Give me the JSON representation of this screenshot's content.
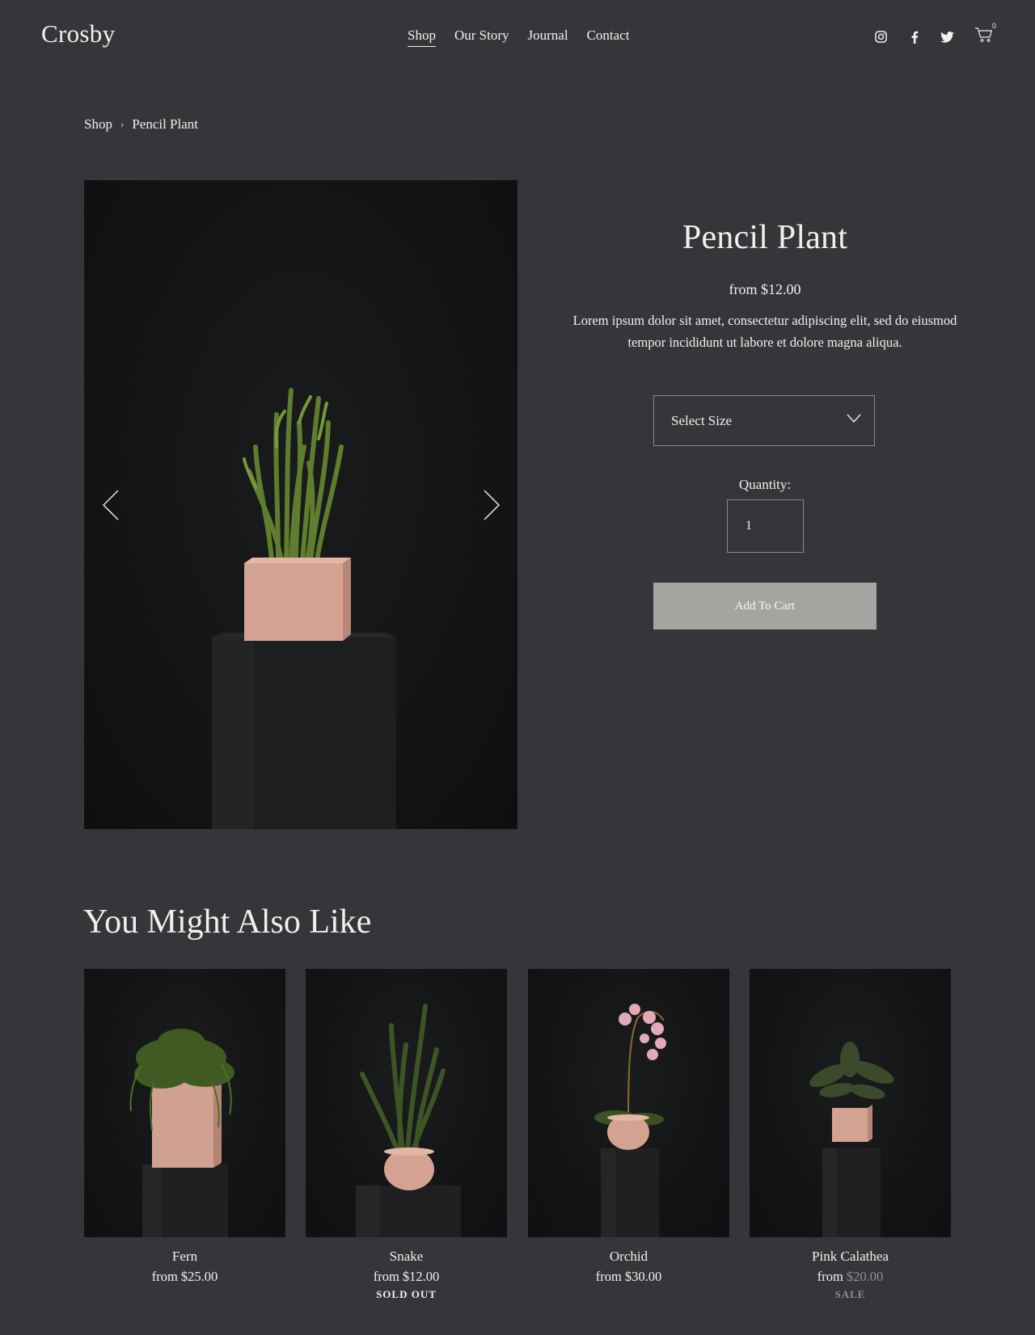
{
  "header": {
    "logo": "Crosby",
    "nav": [
      {
        "label": "Shop",
        "active": true
      },
      {
        "label": "Our Story",
        "active": false
      },
      {
        "label": "Journal",
        "active": false
      },
      {
        "label": "Contact",
        "active": false
      }
    ],
    "social_icons": [
      "instagram-icon",
      "facebook-icon",
      "twitter-icon"
    ],
    "cart_icon": "cart-icon",
    "cart_count": "0"
  },
  "breadcrumb": {
    "root": "Shop",
    "separator": "›",
    "current": "Pencil Plant"
  },
  "product": {
    "title": "Pencil Plant",
    "price": "from $12.00",
    "description": "Lorem ipsum dolor sit amet, consectetur adipiscing elit, sed do eiusmod tempor incididunt ut labore et dolore magna aliqua.",
    "size_select": {
      "selected": "Select Size"
    },
    "quantity_label": "Quantity:",
    "quantity_value": "1",
    "add_to_cart_label": "Add To Cart",
    "image_icons": {
      "prev": "chevron-left-icon",
      "next": "chevron-right-icon"
    }
  },
  "related": {
    "title": "You Might Also Like",
    "items": [
      {
        "name": "Fern",
        "price_prefix": "from ",
        "price": "$25.00",
        "status": "",
        "on_sale": false
      },
      {
        "name": "Snake",
        "price_prefix": "from ",
        "price": "$12.00",
        "status": "SOLD OUT",
        "on_sale": false
      },
      {
        "name": "Orchid",
        "price_prefix": "from ",
        "price": "$30.00",
        "status": "",
        "on_sale": false
      },
      {
        "name": "Pink Calathea",
        "price_prefix": "from ",
        "price": "$20.00",
        "status": "SALE",
        "on_sale": true
      }
    ]
  },
  "colors": {
    "background": "#36363a",
    "text": "#f2f0ec",
    "button": "#a5a4a1",
    "pot_pink": "#d4a291",
    "sale_gray": "#8e8d8f"
  }
}
